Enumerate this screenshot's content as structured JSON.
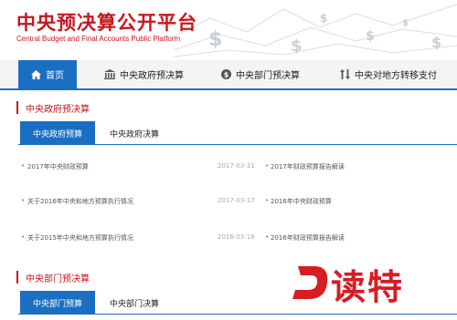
{
  "header": {
    "title": "中央预决算公开平台",
    "subtitle": "Central Budget and Final Accounts Public Platform"
  },
  "nav": {
    "home": "首页",
    "gov_budget": "中央政府预决算",
    "dept_budget": "中央部门预决算",
    "transfer": "中央对地方转移支付"
  },
  "section1": {
    "title": "中央政府预决算",
    "tab_active": "中央政府预算",
    "tab_inactive": "中央政府决算",
    "items": [
      {
        "title": "2017年中央财政预算",
        "date": "2017-03-31",
        "related": "2017年财政预算报告解读"
      },
      {
        "title": "关于2016年中央和地方预算执行情况",
        "date": "2017-03-17",
        "related": "2016年中央财政预算"
      },
      {
        "title": "关于2015年中央和地方预算执行情况",
        "date": "2016-03-18",
        "related": "2016年财政预算报告解读"
      }
    ]
  },
  "section2": {
    "title": "中央部门预决算",
    "tab_active": "中央部门预算",
    "tab_inactive": "中央部门决算"
  },
  "watermark": {
    "text": "读特"
  },
  "colors": {
    "brand_red": "#c8161e",
    "nav_blue": "#1b6fc2"
  }
}
